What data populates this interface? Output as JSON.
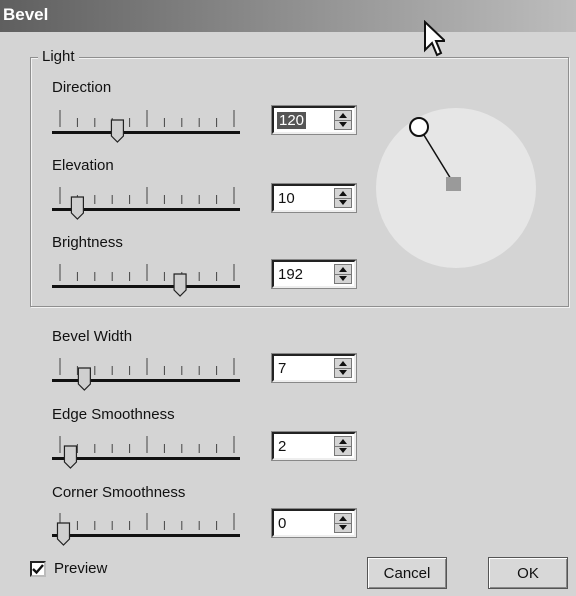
{
  "window": {
    "title": "Bevel"
  },
  "light_group": {
    "legend": "Light",
    "sliders": [
      {
        "label": "Direction",
        "value": "120",
        "position": 0.33,
        "selected": true
      },
      {
        "label": "Elevation",
        "value": "10",
        "position": 0.1,
        "selected": false
      },
      {
        "label": "Brightness",
        "value": "192",
        "position": 0.69,
        "selected": false
      }
    ],
    "light_preview": {
      "angle_deg": 120,
      "dot_color": "#9a9a9a",
      "disc_color": "#e6e6e6"
    }
  },
  "sliders": [
    {
      "label": "Bevel Width",
      "value": "7",
      "position": 0.14
    },
    {
      "label": "Edge Smoothness",
      "value": "2",
      "position": 0.06
    },
    {
      "label": "Corner Smoothness",
      "value": "0",
      "position": 0.02
    }
  ],
  "preview_checkbox": {
    "label": "Preview",
    "checked": true
  },
  "buttons": {
    "cancel": "Cancel",
    "ok": "OK"
  }
}
